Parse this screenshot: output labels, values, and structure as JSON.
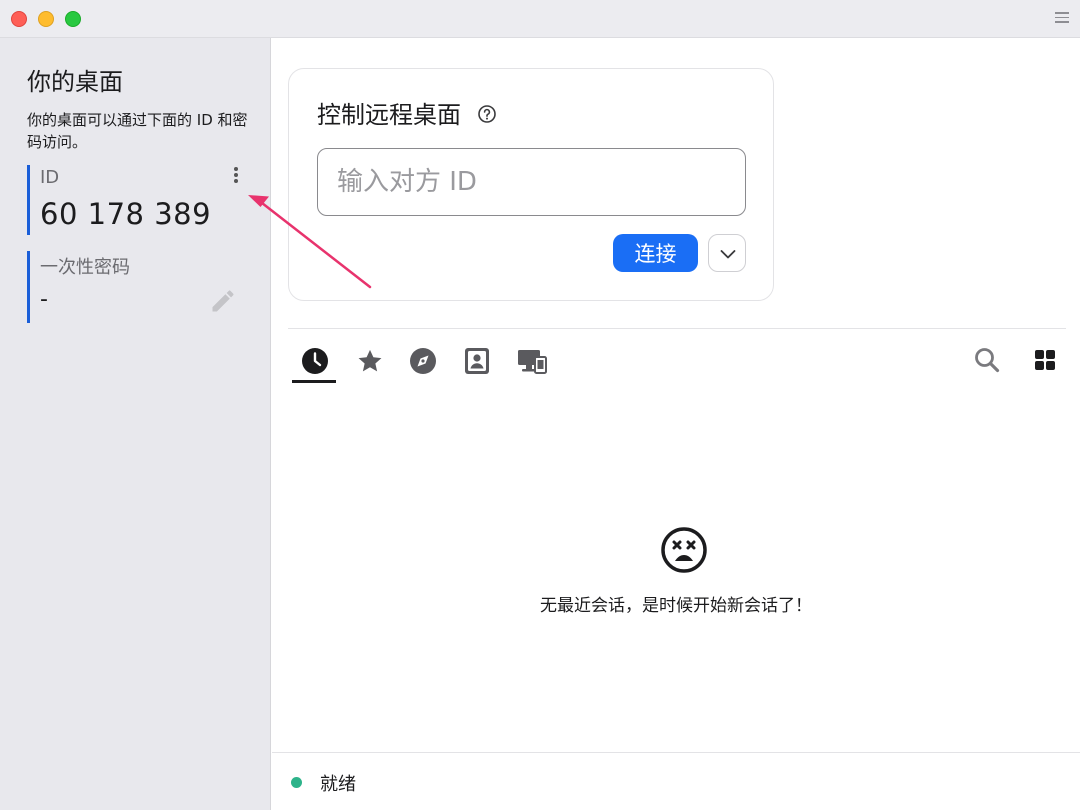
{
  "window": {
    "controls": [
      "close",
      "minimize",
      "zoom"
    ]
  },
  "sidebar": {
    "title": "你的桌面",
    "description": "你的桌面可以通过下面的 ID 和密码访问。",
    "id_label": "ID",
    "id_value": "60 178 389",
    "password_label": "一次性密码",
    "password_value": "-"
  },
  "connect_card": {
    "title": "控制远程桌面",
    "input_placeholder": "输入对方 ID",
    "input_value": "",
    "connect_label": "连接"
  },
  "tabs": [
    {
      "name": "recent",
      "icon": "clock-icon",
      "selected": true
    },
    {
      "name": "favorites",
      "icon": "star-icon",
      "selected": false
    },
    {
      "name": "discovered",
      "icon": "compass-icon",
      "selected": false
    },
    {
      "name": "address-book",
      "icon": "contacts-icon",
      "selected": false
    },
    {
      "name": "group",
      "icon": "devices-icon",
      "selected": false
    }
  ],
  "toolbar": {
    "search_icon": "search-icon",
    "view_icon": "grid-view-icon"
  },
  "empty_state": {
    "icon": "sad-face-icon",
    "message": "无最近会话，是时候开始新会话了！"
  },
  "status": {
    "text": "就绪",
    "color": "#2db38a"
  },
  "colors": {
    "accent": "#1a6ef5",
    "sidebar_bg": "#e8e8ed",
    "annotation": "#e8336d"
  }
}
